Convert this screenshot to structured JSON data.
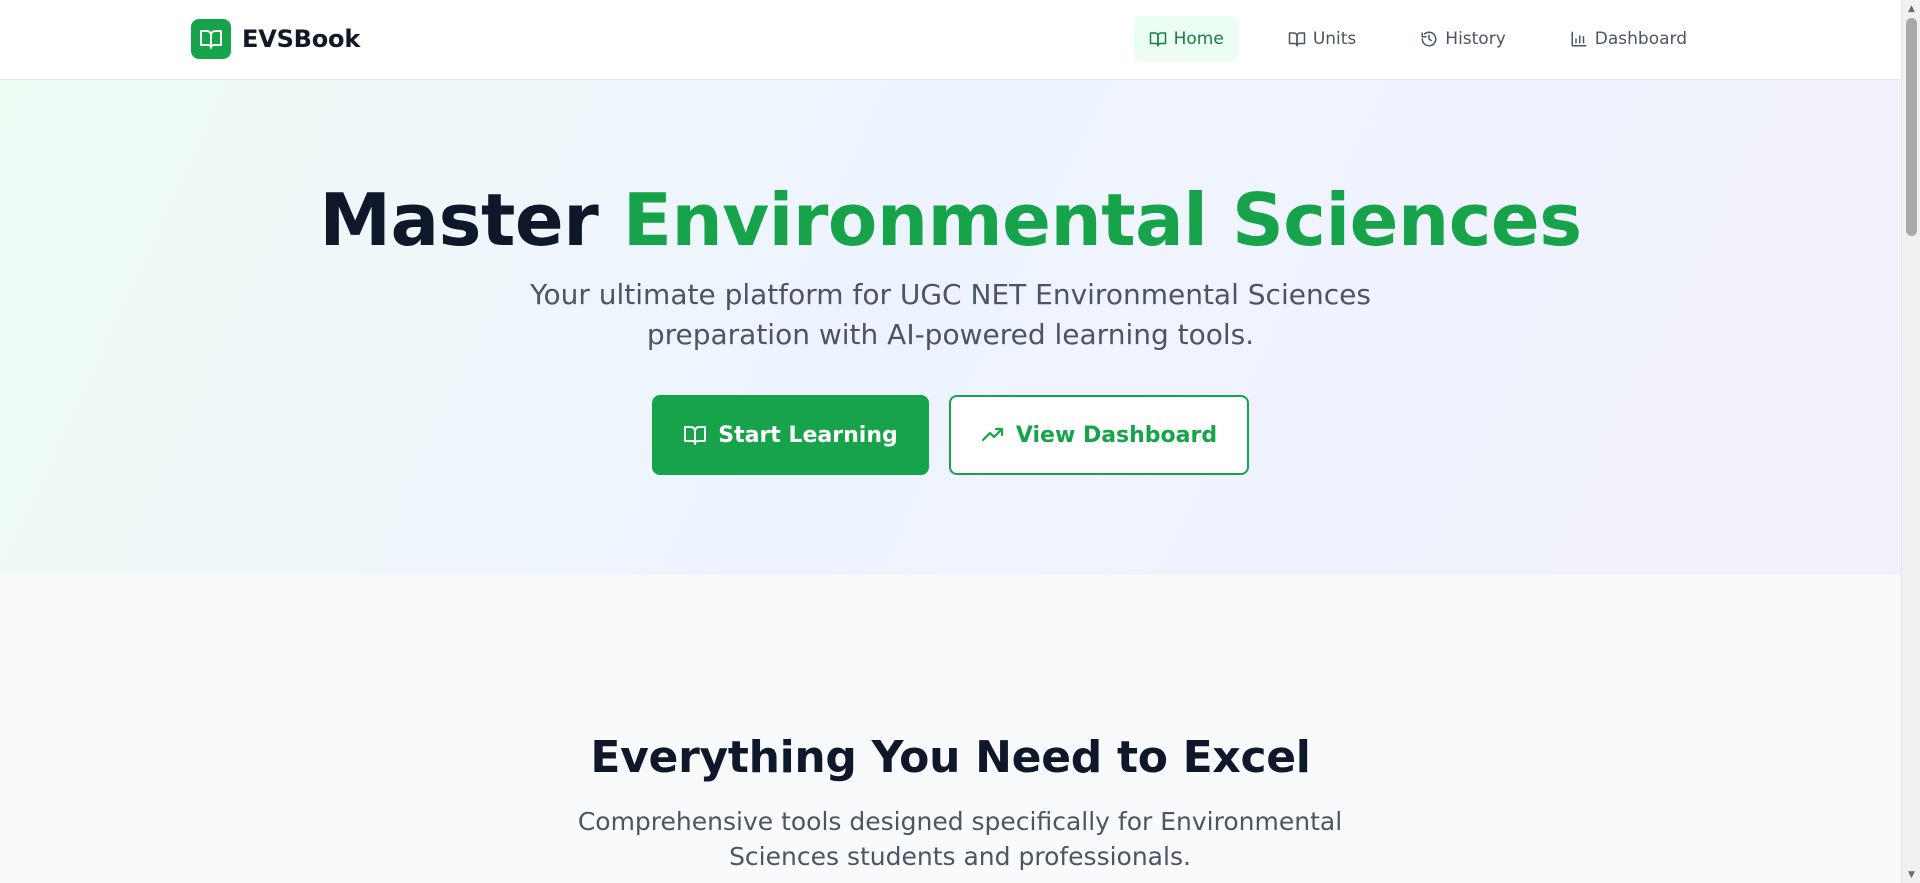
{
  "brand": {
    "name": "EVSBook",
    "icon": "open-book-icon"
  },
  "nav": {
    "items": [
      {
        "label": "Home",
        "icon": "open-book-icon",
        "active": true
      },
      {
        "label": "Units",
        "icon": "open-book-icon",
        "active": false
      },
      {
        "label": "History",
        "icon": "history-icon",
        "active": false
      },
      {
        "label": "Dashboard",
        "icon": "bar-chart-icon",
        "active": false
      }
    ]
  },
  "hero": {
    "title_part1": "Master ",
    "title_part2": "Environmental Sciences",
    "subtitle": "Your ultimate platform for UGC NET Environmental Sciences preparation with AI-powered learning tools.",
    "primary_button": {
      "label": "Start Learning",
      "icon": "open-book-icon"
    },
    "secondary_button": {
      "label": "View Dashboard",
      "icon": "trending-up-icon"
    }
  },
  "features": {
    "title": "Everything You Need to Excel",
    "subtitle": "Comprehensive tools designed specifically for Environmental Sciences students and professionals."
  },
  "colors": {
    "accent": "#16a34a",
    "accent_light": "#ecfdf3",
    "heading": "#0f172a",
    "body_text": "#4b5563"
  }
}
